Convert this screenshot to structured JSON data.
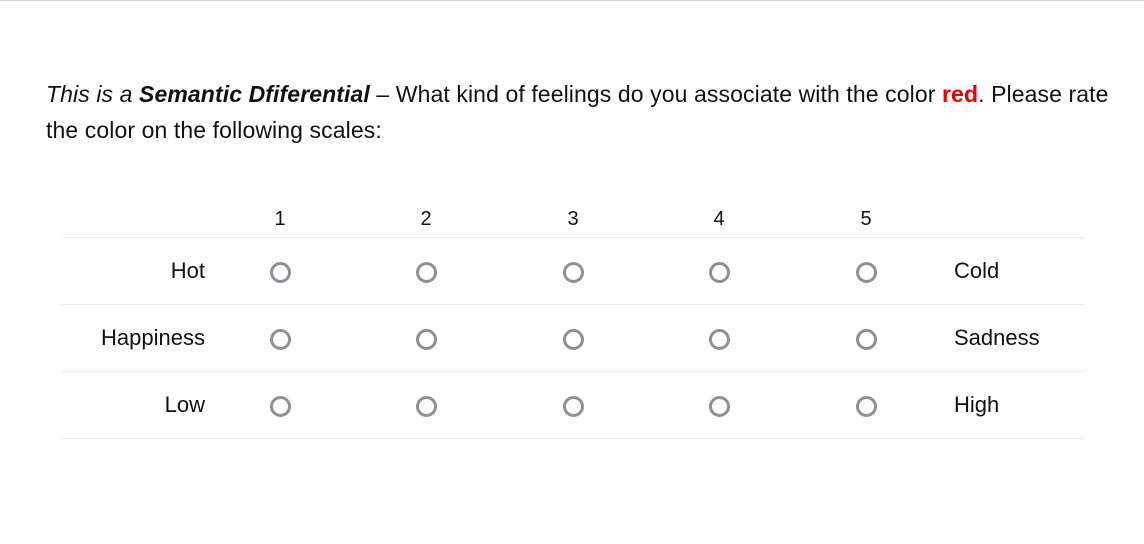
{
  "question": {
    "intro_italic": "This is a ",
    "title": "Semantic Dfiferential",
    "text_before_color": " – What kind of feelings do you associate with the color ",
    "color_word": "red",
    "text_after_color": ". Please rate the color on the following scales:",
    "accent_color": "#e00000"
  },
  "scale": {
    "points": [
      "1",
      "2",
      "3",
      "4",
      "5"
    ]
  },
  "rows": [
    {
      "left": "Hot",
      "right": "Cold"
    },
    {
      "left": "Happiness",
      "right": "Sadness"
    },
    {
      "left": "Low",
      "right": "High"
    }
  ],
  "radio_border_color": "#8e8f99"
}
